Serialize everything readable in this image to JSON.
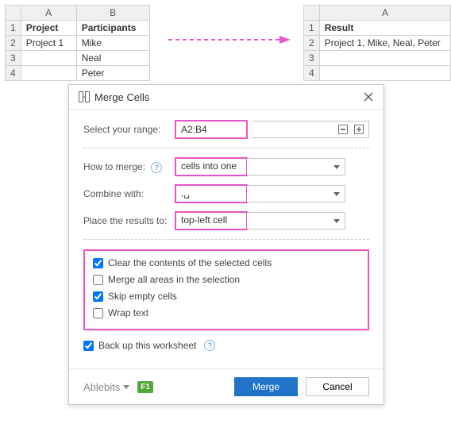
{
  "sheet_left": {
    "cols": [
      "A",
      "B"
    ],
    "rows": [
      "1",
      "2",
      "3",
      "4"
    ],
    "data": [
      [
        "Project",
        "Participants"
      ],
      [
        "Project 1",
        "Mike"
      ],
      [
        "",
        "Neal"
      ],
      [
        "",
        "Peter"
      ]
    ]
  },
  "sheet_right": {
    "cols": [
      "A"
    ],
    "rows": [
      "1",
      "2",
      "3",
      "4"
    ],
    "data": [
      [
        "Result"
      ],
      [
        "Project 1, Mike, Neal, Peter"
      ],
      [
        ""
      ],
      [
        ""
      ]
    ]
  },
  "dialog": {
    "title": "Merge Cells",
    "labels": {
      "select_range": "Select your range:",
      "how_to_merge": "How to merge:",
      "combine_with": "Combine with:",
      "place_results": "Place the results to:"
    },
    "values": {
      "range": "A2:B4",
      "how_to_merge": "cells into one",
      "combine_with": ",␣",
      "place_results": "top-left cell"
    },
    "checks": {
      "clear_contents": {
        "label": "Clear the contents of the selected cells",
        "checked": true
      },
      "merge_all_areas": {
        "label": "Merge all areas in the selection",
        "checked": false
      },
      "skip_empty": {
        "label": "Skip empty cells",
        "checked": true
      },
      "wrap_text": {
        "label": "Wrap text",
        "checked": false
      },
      "backup": {
        "label": "Back up this worksheet",
        "checked": true
      }
    },
    "footer": {
      "brand": "Ablebits",
      "f1": "F1",
      "merge": "Merge",
      "cancel": "Cancel"
    }
  }
}
